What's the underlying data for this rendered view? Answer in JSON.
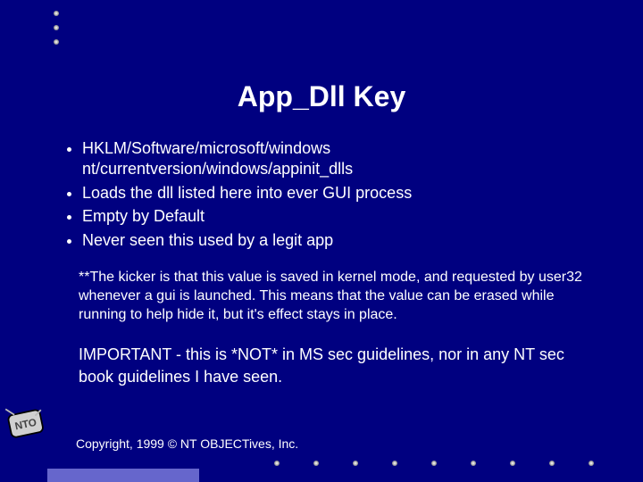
{
  "title": "App_Dll Key",
  "bullets": {
    "b0a": "HKLM/Software/microsoft/windows",
    "b0b": "nt/currentversion/windows/appinit_dlls",
    "b1": "Loads the dll listed here into ever GUI process",
    "b2": "Empty by Default",
    "b3": "Never seen this used by a legit app"
  },
  "note1": "**The kicker is that this value is saved in kernel mode, and requested by user32 whenever a gui is launched. This means that the value can be erased while running to help hide it, but it's effect stays in place.",
  "note2": "IMPORTANT - this is *NOT* in MS sec guidelines, nor in any NT sec book guidelines I have seen.",
  "copyright": "Copyright, 1999 © NT OBJECTives, Inc.",
  "logo_text": "NTO"
}
